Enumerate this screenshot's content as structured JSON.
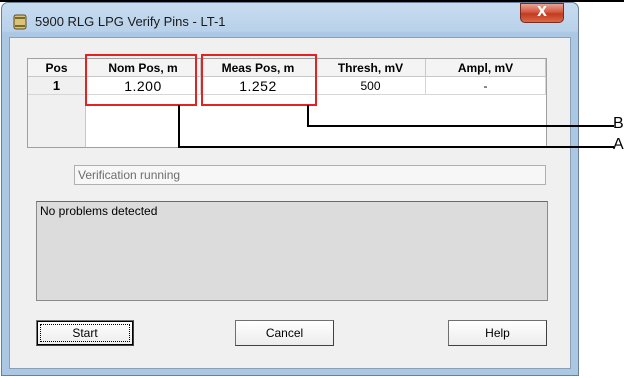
{
  "window": {
    "title": "5900 RLG LPG Verify Pins - LT-1",
    "close_label": "X",
    "icon": "cylinder-tank-icon"
  },
  "grid": {
    "headers": [
      "Pos",
      "Nom Pos, m",
      "Meas Pos, m",
      "Thresh, mV",
      "Ampl, mV"
    ],
    "rows": [
      [
        "1",
        "1.200",
        "1.252",
        "500",
        "-"
      ]
    ]
  },
  "status": {
    "value": "Verification running"
  },
  "messages": {
    "text": "No problems detected"
  },
  "buttons": {
    "start": "Start",
    "cancel": "Cancel",
    "help": "Help"
  },
  "callouts": {
    "a": "A",
    "b": "B"
  },
  "colors": {
    "highlight": "#e52222",
    "close_button": "#c23a1e"
  }
}
